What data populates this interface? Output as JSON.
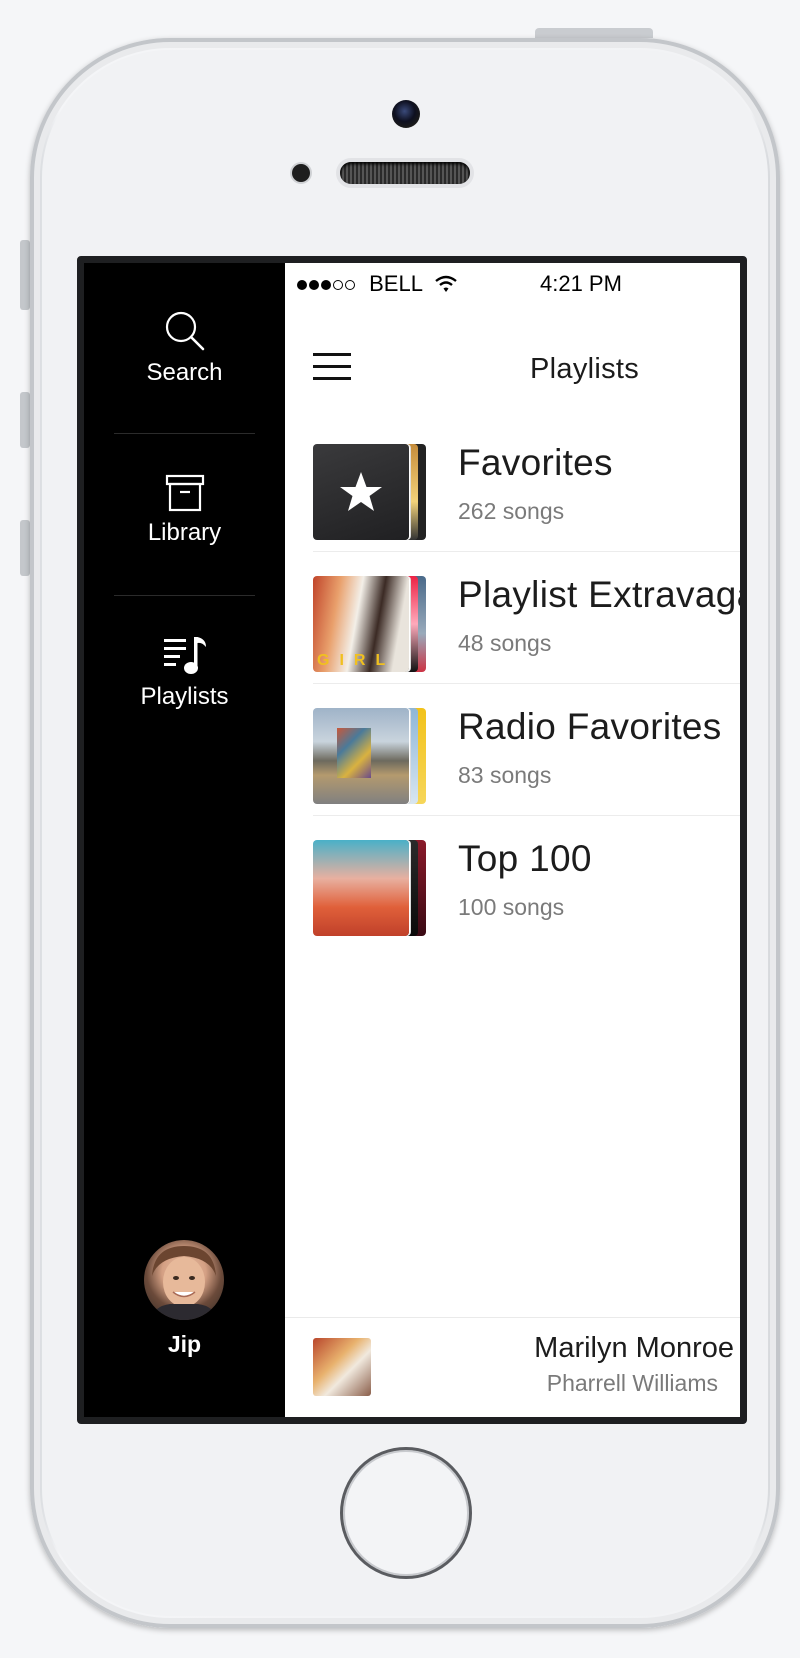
{
  "sidebar": {
    "items": [
      {
        "label": "Search",
        "icon": "search-icon"
      },
      {
        "label": "Library",
        "icon": "archive-box-icon"
      },
      {
        "label": "Playlists",
        "icon": "playlist-music-icon"
      }
    ],
    "user": {
      "name": "Jip"
    }
  },
  "status_bar": {
    "signal_dots": "●●●○○",
    "carrier": "BELL",
    "time": "4:21 PM"
  },
  "header": {
    "title": "Playlists"
  },
  "playlists": [
    {
      "name": "Favorites",
      "count": "262 songs"
    },
    {
      "name": "Playlist Extravaganza",
      "count": "48 songs"
    },
    {
      "name": "Radio Favorites",
      "count": "83 songs"
    },
    {
      "name": "Top 100",
      "count": "100 songs"
    }
  ],
  "now_playing": {
    "title": "Marilyn Monroe",
    "artist": "Pharrell Williams"
  },
  "colors": {
    "sidebar_bg": "#000000",
    "main_bg": "#ffffff",
    "text_primary": "#1c1c1c",
    "text_secondary": "#7a7a7a"
  }
}
